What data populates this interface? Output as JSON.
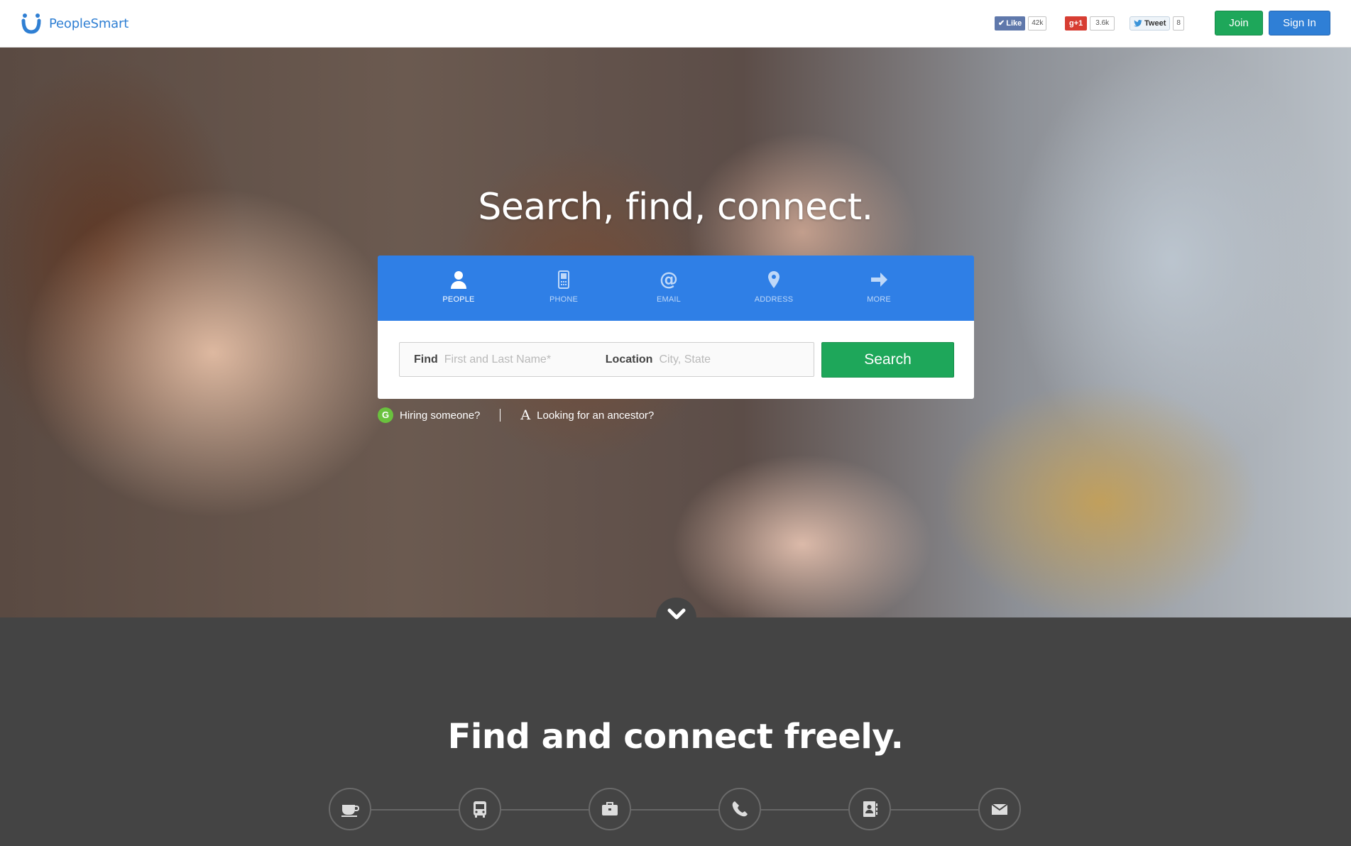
{
  "header": {
    "logo_text": "PeopleSmart",
    "social": {
      "fb_label": "Like",
      "fb_count": "42k",
      "gplus_label": "g+1",
      "gplus_count": "3.6k",
      "tweet_label": "Tweet",
      "tweet_count": "8"
    },
    "join_label": "Join",
    "signin_label": "Sign In"
  },
  "hero": {
    "title": "Search, find, connect.",
    "tabs": [
      {
        "label": "PEOPLE",
        "icon": "person-icon",
        "active": true
      },
      {
        "label": "PHONE",
        "icon": "phone-icon",
        "active": false
      },
      {
        "label": "EMAIL",
        "icon": "at-icon",
        "active": false
      },
      {
        "label": "ADDRESS",
        "icon": "map-pin-icon",
        "active": false
      },
      {
        "label": "MORE",
        "icon": "arrow-right-icon",
        "active": false
      }
    ],
    "find_label": "Find",
    "find_placeholder": "First and Last Name*",
    "location_label": "Location",
    "location_placeholder": "City, State",
    "search_button": "Search",
    "hiring_badge": "G",
    "hiring_link": "Hiring someone?",
    "ancestor_badge": "A",
    "ancestor_link": "Looking for an ancestor?"
  },
  "lower": {
    "title": "Find and connect freely.",
    "icons": [
      "coffee-cup-icon",
      "bus-icon",
      "briefcase-icon",
      "phone-handset-icon",
      "address-book-icon",
      "envelope-icon"
    ]
  },
  "colors": {
    "brand_blue": "#2f7fe6",
    "search_green": "#1ea75a",
    "lower_bg": "#444444"
  }
}
